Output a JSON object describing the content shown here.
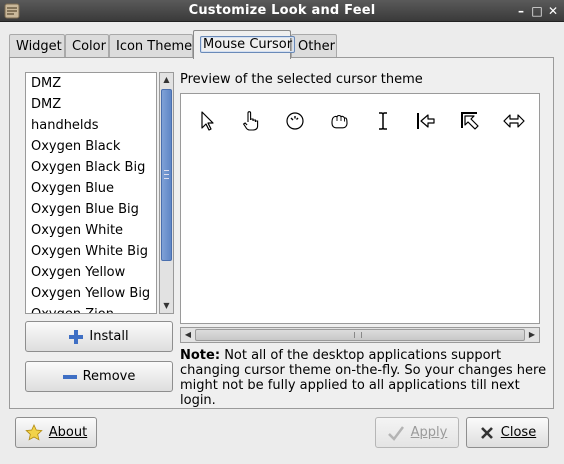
{
  "window": {
    "title": "Customize Look and Feel",
    "controls": {
      "minimize": "–",
      "maximize": "□",
      "close": "✕"
    }
  },
  "tabs": [
    {
      "label": "Widget"
    },
    {
      "label": "Color"
    },
    {
      "label": "Icon Theme"
    },
    {
      "label": "Mouse Cursor",
      "active": true
    },
    {
      "label": "Other"
    }
  ],
  "theme_list": {
    "items": [
      "DMZ",
      "DMZ",
      "handhelds",
      "Oxygen Black",
      "Oxygen Black Big",
      "Oxygen Blue",
      "Oxygen Blue Big",
      "Oxygen White",
      "Oxygen White Big",
      "Oxygen Yellow",
      "Oxygen Yellow Big",
      "Oxygen Zion"
    ]
  },
  "buttons": {
    "install": "Install",
    "remove": "Remove",
    "about": "About",
    "apply": "Apply",
    "close": "Close"
  },
  "preview": {
    "label": "Preview of the selected cursor theme",
    "cursors": [
      "arrow-cursor-icon",
      "hand-pointer-cursor-icon",
      "busy-cursor-icon",
      "grab-hand-cursor-icon",
      "text-ibeam-cursor-icon",
      "left-side-cursor-icon",
      "top-left-corner-cursor-icon",
      "horizontal-resize-cursor-icon"
    ]
  },
  "note": {
    "label": "Note:",
    "text": "Not all of the desktop applications support changing cursor theme on-the-fly. So your changes here might not be fully applied to all applications till next login."
  }
}
